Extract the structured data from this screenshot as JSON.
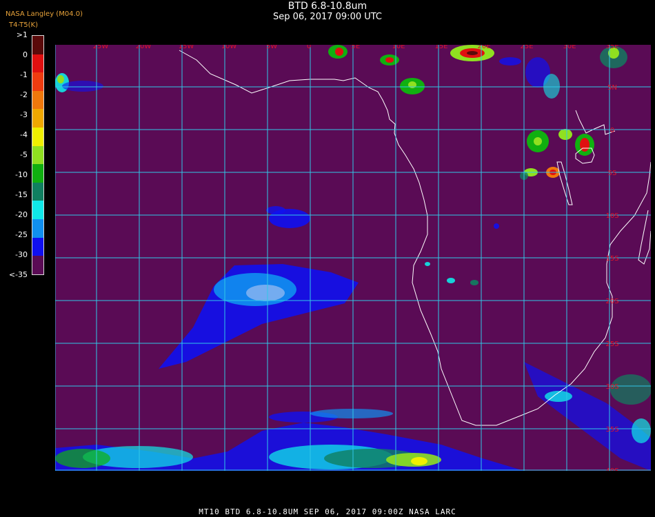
{
  "header": {
    "title": "BTD 6.8-10.8um",
    "subtitle": "Sep 06, 2017 09:00 UTC",
    "credit": "NASA Langley (M04.0)",
    "legend_title": "T4-T5(K)"
  },
  "legend": {
    "labels": [
      ">1",
      "0",
      "-1",
      "-2",
      "-3",
      "-4",
      "-5",
      "-10",
      "-15",
      "-20",
      "-25",
      "-30",
      "<-35"
    ],
    "colors": [
      "#5a0a0a",
      "#e01010",
      "#f03c10",
      "#f0780c",
      "#f0a800",
      "#f0f000",
      "#90e020",
      "#10b010",
      "#108060",
      "#10e8e8",
      "#1090f0",
      "#1010f0",
      "#5a0b55"
    ]
  },
  "map": {
    "background_color": "#5a0b55",
    "grid_color": "#30c8e8",
    "coastline_color": "#ffffff",
    "label_color": "#e0142a",
    "longitude_labels": [
      "25W",
      "20W",
      "15W",
      "10W",
      "5W",
      "0",
      "5E",
      "10E",
      "15E",
      "20E",
      "25E",
      "30E",
      "35E"
    ],
    "latitude_labels": [
      "5N",
      "0",
      "5S",
      "10S",
      "15S",
      "20S",
      "25S",
      "30S",
      "35S",
      "40S"
    ]
  },
  "footer": {
    "text": "MT10  BTD 6.8-10.8UM   SEP 06, 2017 09:00Z   NASA LARC"
  }
}
